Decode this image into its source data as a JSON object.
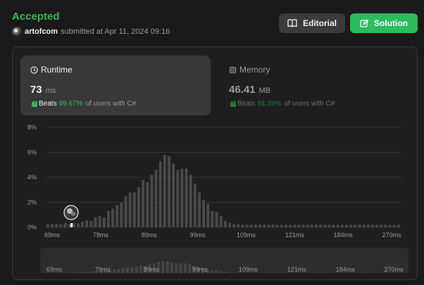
{
  "submission": {
    "status": "Accepted",
    "user": "artofcom",
    "submitted_text": "submitted at Apr 11, 2024 09:16"
  },
  "buttons": {
    "editorial_label": "Editorial",
    "editorial_icon": "book-icon",
    "solution_label": "Solution",
    "solution_icon": "edit-icon"
  },
  "runtime": {
    "title": "Runtime",
    "value": "73",
    "unit": "ms",
    "beats_label": "Beats",
    "beats_pct": "99.67%",
    "beats_suffix": "of users with C#"
  },
  "memory": {
    "title": "Memory",
    "value": "46.41",
    "unit": "MB",
    "beats_label": "Beats",
    "beats_pct": "91.39%",
    "beats_suffix": "of users with C#"
  },
  "colors": {
    "accent": "#2cbb5d",
    "bar": "#4a4a4a",
    "background": "#1a1a1a"
  },
  "chart_data": {
    "type": "bar",
    "y_ticks": [
      "8%",
      "6%",
      "4%",
      "2%",
      "0%"
    ],
    "y_tick_values": [
      8,
      6,
      4,
      2,
      0
    ],
    "ylim": [
      0,
      8
    ],
    "x_ticks": [
      "69ms",
      "79ms",
      "89ms",
      "99ms",
      "109ms",
      "121ms",
      "184ms",
      "270ms"
    ],
    "values": [
      0.25,
      0.25,
      0.25,
      0.25,
      0.35,
      0.25,
      0.35,
      0.3,
      0.45,
      0.55,
      0.5,
      0.8,
      0.9,
      0.8,
      1.3,
      1.5,
      1.8,
      2.0,
      2.5,
      2.8,
      2.8,
      3.2,
      3.8,
      3.6,
      4.2,
      4.6,
      5.3,
      5.8,
      5.7,
      5.1,
      4.6,
      4.7,
      4.7,
      4.2,
      3.5,
      2.8,
      2.2,
      1.9,
      1.3,
      1.25,
      0.9,
      0.5,
      0.35,
      0.25,
      0.25,
      0.2,
      0.2,
      0.2,
      0.2,
      0.2,
      0.2,
      0.2,
      0.2,
      0.2,
      0.2,
      0.2,
      0.2,
      0.2,
      0.2,
      0.2,
      0.2,
      0.2,
      0.2,
      0.2,
      0.2,
      0.2,
      0.2,
      0.2,
      0.2,
      0.2,
      0.2,
      0.2,
      0.2,
      0.2,
      0.2,
      0.2,
      0.2,
      0.2,
      0.2,
      0.2,
      0.2,
      0.2
    ],
    "marker": {
      "x": "73ms",
      "icon": "user-avatar-icon"
    },
    "grid": true
  }
}
